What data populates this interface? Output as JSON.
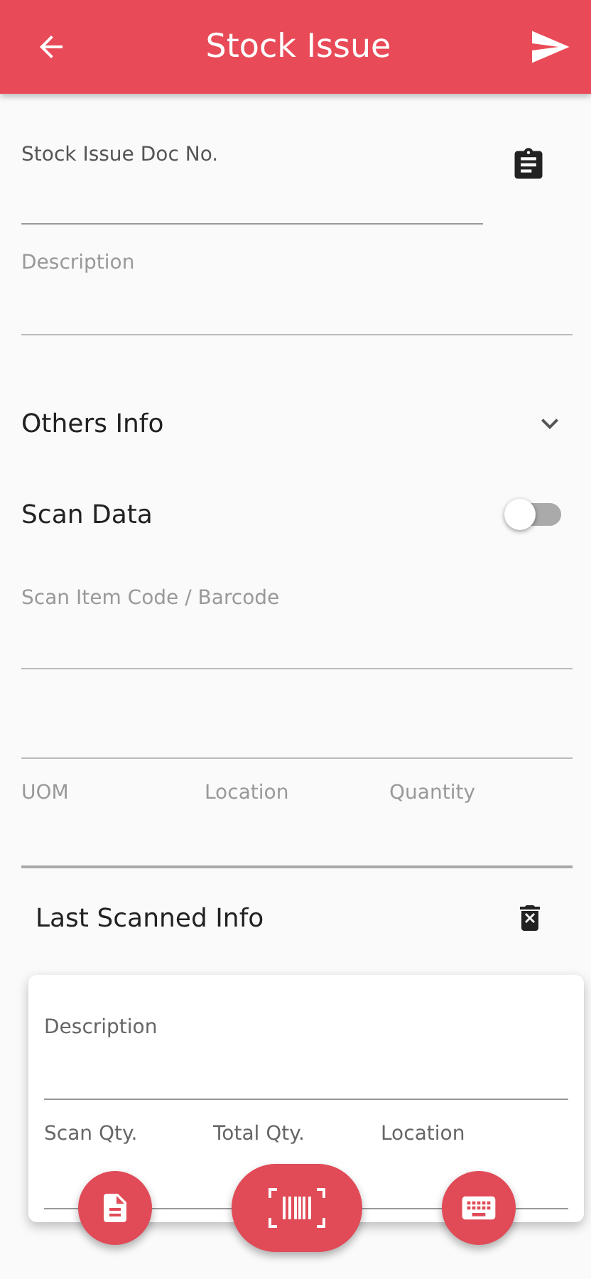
{
  "app_bar": {
    "title": "Stock Issue"
  },
  "doc_field": {
    "label": "Stock Issue Doc No."
  },
  "description_field": {
    "placeholder": "Description"
  },
  "others_info": {
    "title": "Others Info",
    "expanded": false
  },
  "scan_data": {
    "title": "Scan Data",
    "on": false
  },
  "scan_field": {
    "placeholder": "Scan Item Code / Barcode"
  },
  "detail_columns": [
    "UOM",
    "Location",
    "Quantity"
  ],
  "last_scanned": {
    "title": "Last Scanned Info",
    "description_label": "Description",
    "columns": [
      "Scan Qty.",
      "Total Qty.",
      "Location"
    ]
  }
}
